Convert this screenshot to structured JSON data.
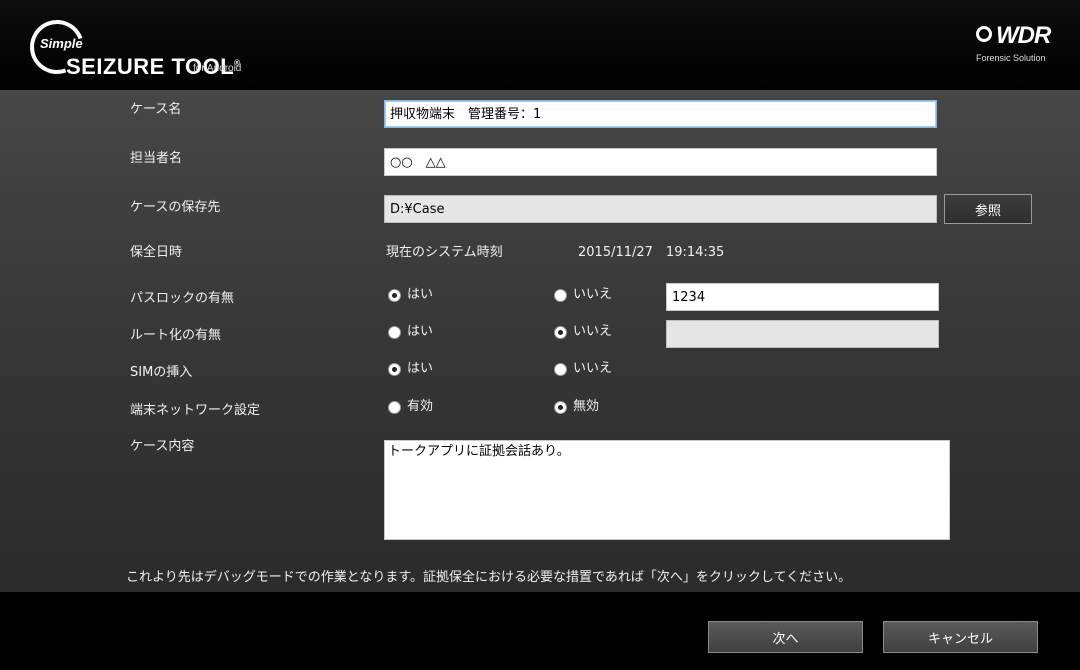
{
  "header": {
    "logo_simple": "Simple",
    "logo_main": "SEIZURE TOOL",
    "logo_reg": "®",
    "logo_sub": "for Android",
    "brand": "WDR",
    "brand_sub": "Forensic Solution"
  },
  "form": {
    "case_name": {
      "label": "ケース名",
      "value": "押収物端末　管理番号：1"
    },
    "officer": {
      "label": "担当者名",
      "value": "○○　△△"
    },
    "save_path": {
      "label": "ケースの保存先",
      "value": "D:¥Case",
      "browse_label": "参照"
    },
    "preserve_time": {
      "label": "保全日時",
      "mode": "現在のシステム時刻",
      "datetime": "2015/11/27　19:14:35"
    },
    "passlock": {
      "label": "パスロックの有無",
      "yes": "はい",
      "no": "いいえ",
      "selected": "yes",
      "code": "1234"
    },
    "root": {
      "label": "ルート化の有無",
      "yes": "はい",
      "no": "いいえ",
      "selected": "no",
      "code": ""
    },
    "sim": {
      "label": "SIMの挿入",
      "yes": "はい",
      "no": "いいえ",
      "selected": "yes"
    },
    "network": {
      "label": "端末ネットワーク設定",
      "enabled": "有効",
      "disabled": "無効",
      "selected": "disabled"
    },
    "case_content": {
      "label": "ケース内容",
      "value": "トークアプリに証拠会話あり。"
    }
  },
  "notice": "これより先はデバッグモードでの作業となります。証拠保全における必要な措置であれば「次へ」をクリックしてください。",
  "footer": {
    "next_label": "次へ",
    "cancel_label": "キャンセル"
  }
}
